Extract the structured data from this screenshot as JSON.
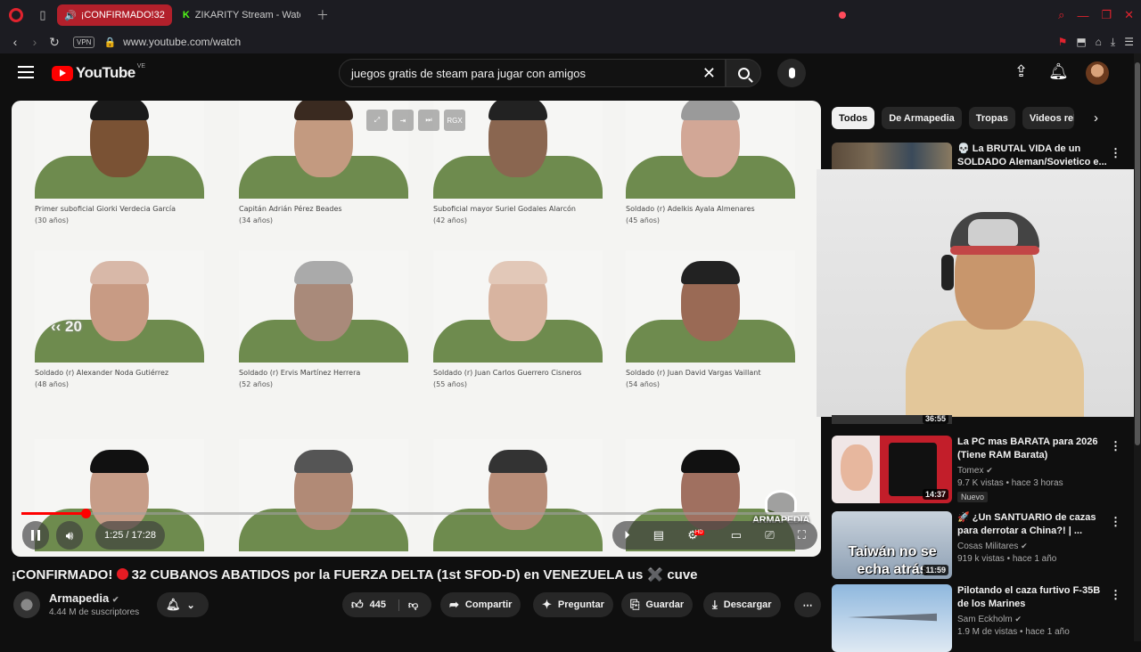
{
  "browser": {
    "active_tab": {
      "title": "¡CONFIRMADO!",
      "badge": "32"
    },
    "other_tab": {
      "title": "ZIKARITY Stream - Watch"
    },
    "url": "www.youtube.com/watch",
    "vpn_label": "VPN"
  },
  "header": {
    "logo_text": "YouTube",
    "country_code": "VE",
    "search_value": "juegos gratis de steam para jugar con amigos"
  },
  "player": {
    "cards": [
      {
        "caption": "Primer suboficial Giorki Verdecia García",
        "age": "(30 años)",
        "skin": "#7a5234",
        "hair": "#1a1a1a"
      },
      {
        "caption": "Capitán Adrián Pérez Beades",
        "age": "(34 años)",
        "skin": "#c39a80",
        "hair": "#3a2a20"
      },
      {
        "caption": "Suboficial mayor Suriel Godales Alarcón",
        "age": "(42 años)",
        "skin": "#8a6650",
        "hair": "#222"
      },
      {
        "caption": "Soldado (r) Adelkis Ayala Almenares",
        "age": "(45 años)",
        "skin": "#d2a796",
        "hair": "#9a9a9a"
      },
      {
        "caption": "Soldado (r) Alexander Noda Gutiérrez",
        "age": "(48 años)",
        "skin": "#c89b84",
        "hair": "#d8b8a8"
      },
      {
        "caption": "Soldado (r) Ervis Martínez Herrera",
        "age": "(52 años)",
        "skin": "#a98a7a",
        "hair": "#aaa"
      },
      {
        "caption": "Soldado (r) Juan Carlos Guerrero Cisneros",
        "age": "(55 años)",
        "skin": "#d8b4a0",
        "hair": "#e2c8b8"
      },
      {
        "caption": "Soldado (r) Juan David Vargas Vaillant",
        "age": "(54 años)",
        "skin": "#9a6a55",
        "hair": "#222"
      },
      {
        "caption": "",
        "age": "",
        "skin": "#c79d88",
        "hair": "#111"
      },
      {
        "caption": "",
        "age": "",
        "skin": "#b18a76",
        "hair": "#555"
      },
      {
        "caption": "",
        "age": "",
        "skin": "#b88d78",
        "hair": "#333"
      },
      {
        "caption": "",
        "age": "",
        "skin": "#a07060",
        "hair": "#111"
      }
    ],
    "overlay_buttons": [
      "⤢",
      "⇥",
      "⏭",
      "RGX"
    ],
    "skip_label": "20",
    "watermark_text": "ARMAPEDIA",
    "time_display": "1:25 / 17:28",
    "progress_fraction": 0.0811
  },
  "video": {
    "title_prefix": "¡CONFIRMADO!",
    "title_rest": "32 CUBANOS ABATIDOS por la FUERZA DELTA (1st SFOD-D) en VENEZUELA us ✖️ cuve",
    "channel": "Armapedia",
    "subscribers": "4.44 M de suscriptores",
    "likes": "445",
    "share": "Compartir",
    "ask": "Preguntar",
    "save": "Guardar",
    "download": "Descargar"
  },
  "sidebar": {
    "chips": [
      "Todos",
      "De Armapedia",
      "Tropas",
      "Videos rela"
    ],
    "recommendations": [
      {
        "title": "💀 La BRUTAL VIDA de un SOLDADO Aleman/Sovietico e...",
        "channel": "",
        "meta": "",
        "duration": "36:55",
        "badge": ""
      },
      {
        "title": "La PC mas BARATA para 2026 (Tiene RAM Barata)",
        "channel": "Tomex",
        "meta": "9.7 K vistas • hace 3 horas",
        "duration": "14:37",
        "badge": "Nuevo"
      },
      {
        "title": "🚀 ¿Un SANTUARIO de cazas para derrotar a China?! | ...",
        "channel": "Cosas Militares",
        "meta": "919 k vistas • hace 1 año",
        "duration": "11:59",
        "badge": "",
        "thumb_text": "Taiwán no se echa atrás"
      },
      {
        "title": "Pilotando el caza furtivo F-35B de los Marines",
        "channel": "Sam Eckholm",
        "meta": "1.9 M de vistas • hace 1 año",
        "duration": "",
        "badge": ""
      }
    ]
  }
}
